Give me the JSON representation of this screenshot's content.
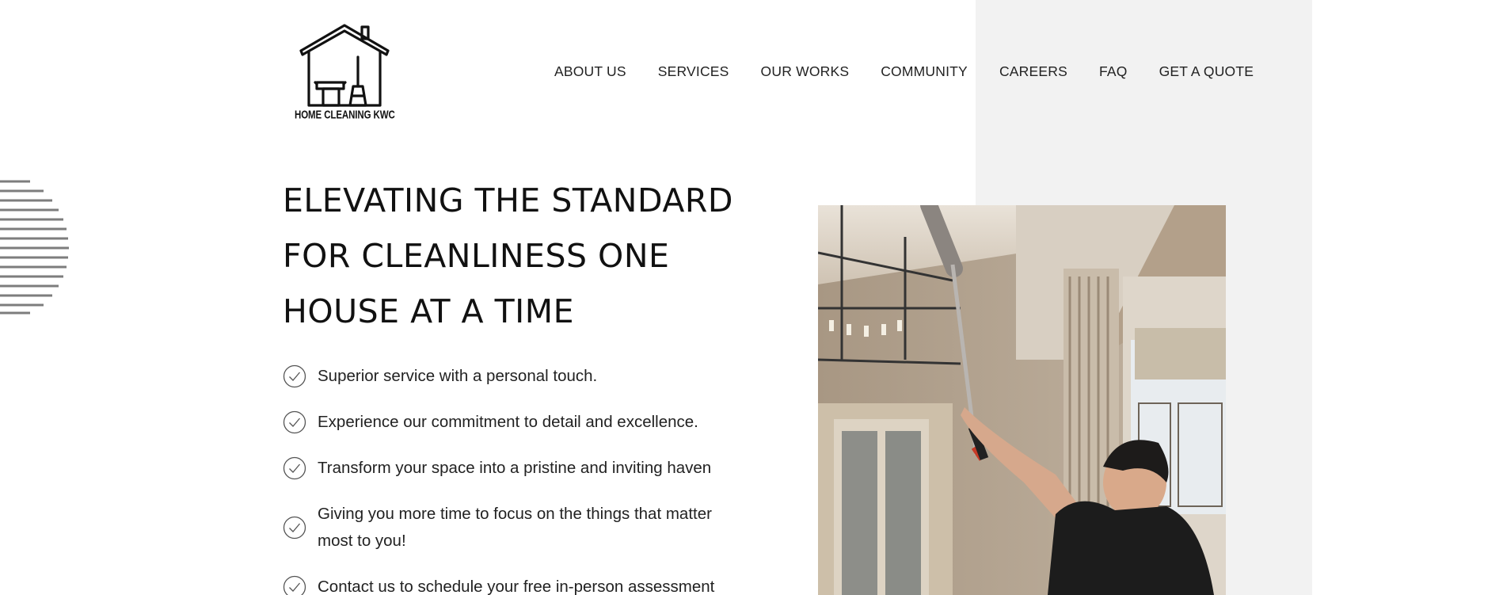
{
  "logo": {
    "icon": "house-cleaning-logo-icon",
    "text": "HOME CLEANING KWC"
  },
  "nav": {
    "items": [
      {
        "label": "ABOUT US"
      },
      {
        "label": "SERVICES"
      },
      {
        "label": "OUR WORKS"
      },
      {
        "label": "COMMUNITY"
      },
      {
        "label": "CAREERS"
      },
      {
        "label": "FAQ"
      },
      {
        "label": "GET A QUOTE"
      }
    ]
  },
  "hero": {
    "title_lines": [
      "ELEVATING THE STANDARD",
      "FOR CLEANLINESS ONE",
      "HOUSE AT A TIME"
    ],
    "features": [
      {
        "icon": "check-circle-icon",
        "text": "Superior service with a personal touch."
      },
      {
        "icon": "check-circle-icon",
        "text": "Experience our commitment to detail and excellence."
      },
      {
        "icon": "check-circle-icon",
        "text": "Transform your space into a pristine and inviting haven"
      },
      {
        "icon": "check-circle-icon",
        "text": "Giving you more time to focus on the things that matter most to you!"
      },
      {
        "icon": "check-circle-icon",
        "text": "Contact us to schedule your free in-person assessment"
      }
    ]
  },
  "colors": {
    "panel_gray": "#f2f2f2",
    "text": "#1a1a1a",
    "stripe_gray": "#808080"
  }
}
